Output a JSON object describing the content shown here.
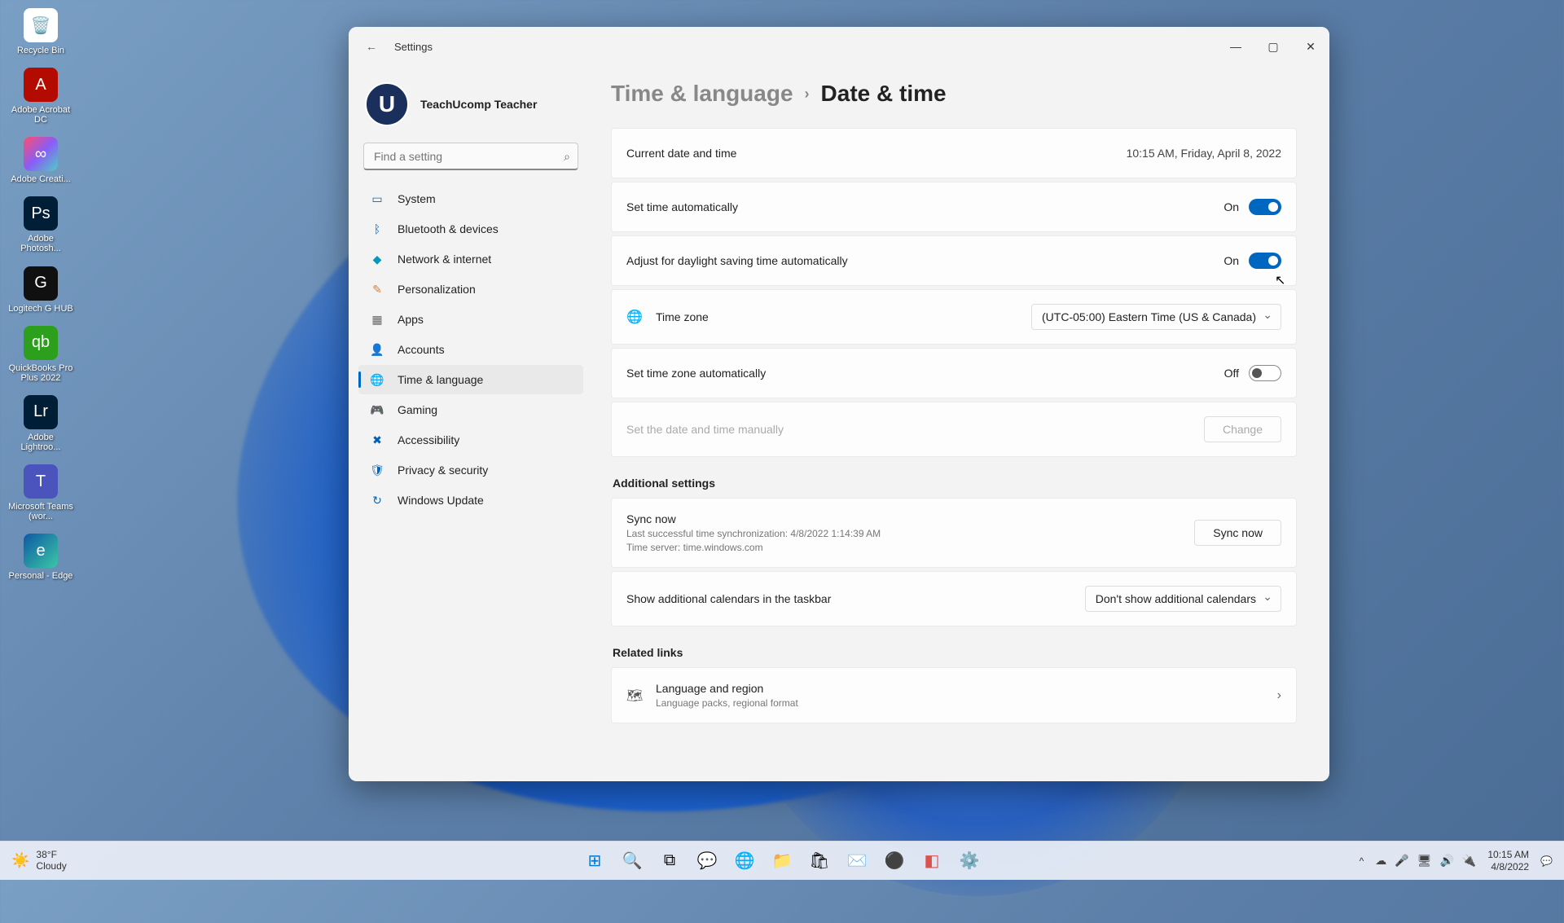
{
  "desktop": {
    "icons": [
      {
        "label": "Recycle Bin",
        "bg": "#ffffff",
        "glyph": "🗑️"
      },
      {
        "label": "Adobe Acrobat DC",
        "bg": "#b30b00",
        "glyph": "A"
      },
      {
        "label": "Adobe Creati...",
        "bg": "linear-gradient(135deg,#ff4d6d,#8a5cf6,#4ecdc4)",
        "glyph": "∞"
      },
      {
        "label": "Adobe Photosh...",
        "bg": "#001e36",
        "glyph": "Ps"
      },
      {
        "label": "Logitech G HUB",
        "bg": "#101010",
        "glyph": "G"
      },
      {
        "label": "QuickBooks Pro Plus 2022",
        "bg": "#2ca01c",
        "glyph": "qb"
      },
      {
        "label": "Adobe Lightroo...",
        "bg": "#001e36",
        "glyph": "Lr"
      },
      {
        "label": "Microsoft Teams (wor...",
        "bg": "#4b53bc",
        "glyph": "T"
      },
      {
        "label": "Personal - Edge",
        "bg": "linear-gradient(135deg,#0c59a4,#3cc7a6)",
        "glyph": "e"
      }
    ]
  },
  "window": {
    "title": "Settings",
    "profile_name": "TeachUcomp Teacher",
    "search_placeholder": "Find a setting"
  },
  "sidebar": {
    "items": [
      {
        "label": "System",
        "color": "#0067c0",
        "glyph": "▭"
      },
      {
        "label": "Bluetooth & devices",
        "color": "#0067c0",
        "glyph": "ᛒ"
      },
      {
        "label": "Network & internet",
        "color": "#0099bc",
        "glyph": "◆"
      },
      {
        "label": "Personalization",
        "color": "#d97f3a",
        "glyph": "✎"
      },
      {
        "label": "Apps",
        "color": "#666",
        "glyph": "▦"
      },
      {
        "label": "Accounts",
        "color": "#1aa260",
        "glyph": "👤"
      },
      {
        "label": "Time & language",
        "color": "#0067c0",
        "glyph": "🌐"
      },
      {
        "label": "Gaming",
        "color": "#666",
        "glyph": "🎮"
      },
      {
        "label": "Accessibility",
        "color": "#005fb8",
        "glyph": "✖"
      },
      {
        "label": "Privacy & security",
        "color": "#0067c0",
        "glyph": "🛡"
      },
      {
        "label": "Windows Update",
        "color": "#0067c0",
        "glyph": "↻"
      }
    ],
    "active_index": 6
  },
  "breadcrumb": {
    "parent": "Time & language",
    "current": "Date & time"
  },
  "content": {
    "current_dt_label": "Current date and time",
    "current_dt_value": "10:15 AM, Friday, April 8, 2022",
    "set_time_auto": {
      "label": "Set time automatically",
      "state": "On",
      "on": true
    },
    "dst_auto": {
      "label": "Adjust for daylight saving time automatically",
      "state": "On",
      "on": true
    },
    "timezone": {
      "label": "Time zone",
      "value": "(UTC-05:00) Eastern Time (US & Canada)"
    },
    "tz_auto": {
      "label": "Set time zone automatically",
      "state": "Off",
      "on": false
    },
    "manual": {
      "label": "Set the date and time manually",
      "button": "Change"
    },
    "additional_heading": "Additional settings",
    "sync": {
      "title": "Sync now",
      "line1": "Last successful time synchronization: 4/8/2022 1:14:39 AM",
      "line2": "Time server: time.windows.com",
      "button": "Sync now"
    },
    "calendars": {
      "label": "Show additional calendars in the taskbar",
      "value": "Don't show additional calendars"
    },
    "related_heading": "Related links",
    "lang_region": {
      "title": "Language and region",
      "sub": "Language packs, regional format"
    }
  },
  "taskbar": {
    "weather_temp": "38°F",
    "weather_cond": "Cloudy",
    "time": "10:15 AM",
    "date": "4/8/2022"
  }
}
